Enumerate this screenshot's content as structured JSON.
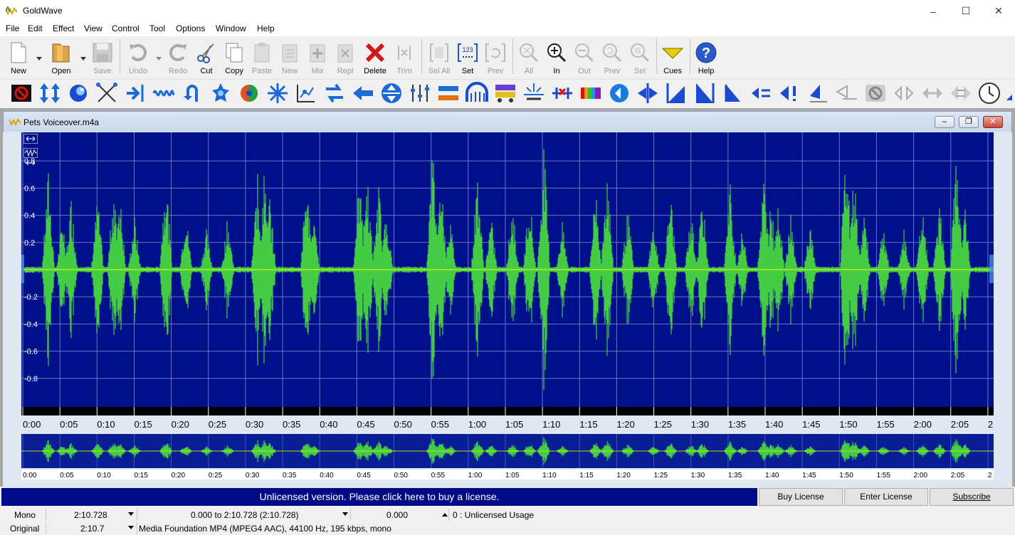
{
  "window": {
    "title": "GoldWave",
    "minimize": "–",
    "maximize": "☐",
    "close": "✕"
  },
  "menu": [
    "File",
    "Edit",
    "Effect",
    "View",
    "Control",
    "Tool",
    "Options",
    "Window",
    "Help"
  ],
  "toolbar": [
    {
      "label": "New",
      "icon": "new-file-icon",
      "enabled": true
    },
    {
      "label": "Open",
      "icon": "open-folder-icon",
      "enabled": true
    },
    {
      "label": "Save",
      "icon": "save-disk-icon",
      "enabled": false
    },
    {
      "label": "Undo",
      "icon": "undo-icon",
      "enabled": false
    },
    {
      "label": "Redo",
      "icon": "redo-icon",
      "enabled": false
    },
    {
      "label": "Cut",
      "icon": "scissors-icon",
      "enabled": true
    },
    {
      "label": "Copy",
      "icon": "copy-icon",
      "enabled": true
    },
    {
      "label": "Paste",
      "icon": "paste-icon",
      "enabled": false
    },
    {
      "label": "New",
      "icon": "paste-new-icon",
      "enabled": false
    },
    {
      "label": "Mix",
      "icon": "mix-icon",
      "enabled": false
    },
    {
      "label": "Repl",
      "icon": "replace-icon",
      "enabled": false
    },
    {
      "label": "Delete",
      "icon": "delete-x-icon",
      "enabled": true
    },
    {
      "label": "Trim",
      "icon": "trim-icon",
      "enabled": false
    },
    {
      "label": "Sel All",
      "icon": "select-all-icon",
      "enabled": false
    },
    {
      "label": "Set",
      "icon": "set-selection-icon",
      "enabled": true
    },
    {
      "label": "Prev",
      "icon": "previous-selection-icon",
      "enabled": false
    },
    {
      "label": "All",
      "icon": "zoom-all-icon",
      "enabled": false
    },
    {
      "label": "In",
      "icon": "zoom-in-icon",
      "enabled": true
    },
    {
      "label": "Out",
      "icon": "zoom-out-icon",
      "enabled": false
    },
    {
      "label": "Prev",
      "icon": "zoom-previous-icon",
      "enabled": false
    },
    {
      "label": "Sel",
      "icon": "zoom-selection-icon",
      "enabled": false
    },
    {
      "label": "Cues",
      "icon": "cues-icon",
      "enabled": true
    },
    {
      "label": "Help",
      "icon": "help-icon",
      "enabled": true
    }
  ],
  "effects_toolbar": [
    "noise-stop-icon",
    "auto-gain-icon",
    "doppler-icon",
    "channel-mixer-icon",
    "compressor-icon",
    "echo-icon",
    "equalizer-icon",
    "flanger-icon",
    "invert-icon",
    "mechanize-icon",
    "noise-reduction-icon",
    "offset-icon",
    "pan-icon",
    "pitch-icon",
    "playback-rate-icon",
    "resample-icon",
    "reverse-icon",
    "silence-icon",
    "smoother-icon",
    "spatial-expander-icon",
    "spectrum-filter-icon",
    "stereo-icon",
    "time-warp-icon",
    "volume-icon",
    "fade-in-icon",
    "fade-out-icon",
    "match-volume-icon",
    "shape-volume-icon",
    "maximize-icon",
    "change-volume-icon",
    "play-icon",
    "skip-icon",
    "loop-icon",
    "mute-icon",
    "record-icon",
    "clock-icon"
  ],
  "document": {
    "title": "Pets Voiceover.m4a",
    "colors": {
      "background": "#00108a",
      "wave": "#44cc44",
      "grid": "#6f74c7",
      "center": "#ffff00"
    },
    "y_labels": [
      "0.8",
      "0.6",
      "0.4",
      "0.2",
      "0.0",
      "-0.2",
      "-0.4",
      "-0.6",
      "-0.8"
    ],
    "time_labels": [
      "0:00",
      "0:05",
      "0:10",
      "0:15",
      "0:20",
      "0:25",
      "0:30",
      "0:35",
      "0:40",
      "0:45",
      "0:50",
      "0:55",
      "1:00",
      "1:05",
      "1:10",
      "1:15",
      "1:20",
      "1:25",
      "1:30",
      "1:35",
      "1:40",
      "1:45",
      "1:50",
      "1:55",
      "2:00",
      "2:05",
      "2"
    ],
    "overview_labels": [
      "0:00",
      "0:05",
      "0:10",
      "0:15",
      "0:20",
      "0:25",
      "0:30",
      "0:35",
      "0:40",
      "0:45",
      "0:50",
      "0:55",
      "1:00",
      "1:05",
      "1:10",
      "1:15",
      "1:20",
      "1:25",
      "1:30",
      "1:35",
      "1:40",
      "1:45",
      "1:50",
      "1:55",
      "2:00",
      "2:05",
      "2"
    ],
    "controls": {
      "minimize": "–",
      "restore": "❐",
      "close": "✕"
    },
    "icons": [
      "fit-width-icon",
      "waveform-view-icon",
      "expand-icon"
    ]
  },
  "banner": {
    "text": "Unlicensed version. Please click here to buy a license.",
    "buy": "Buy License",
    "enter": "Enter License",
    "subscribe": "Subscribe"
  },
  "status": {
    "row1": {
      "channels": "Mono",
      "length": "2:10.728",
      "selection": "0.000 to 2:10.728 (2:10.728)",
      "position": "0.000",
      "license": "0 : Unlicensed Usage"
    },
    "row2": {
      "label": "Original",
      "length": "2:10.7",
      "format": "Media Foundation MP4 (MPEG4 AAC), 44100 Hz, 195 kbps, mono"
    }
  }
}
